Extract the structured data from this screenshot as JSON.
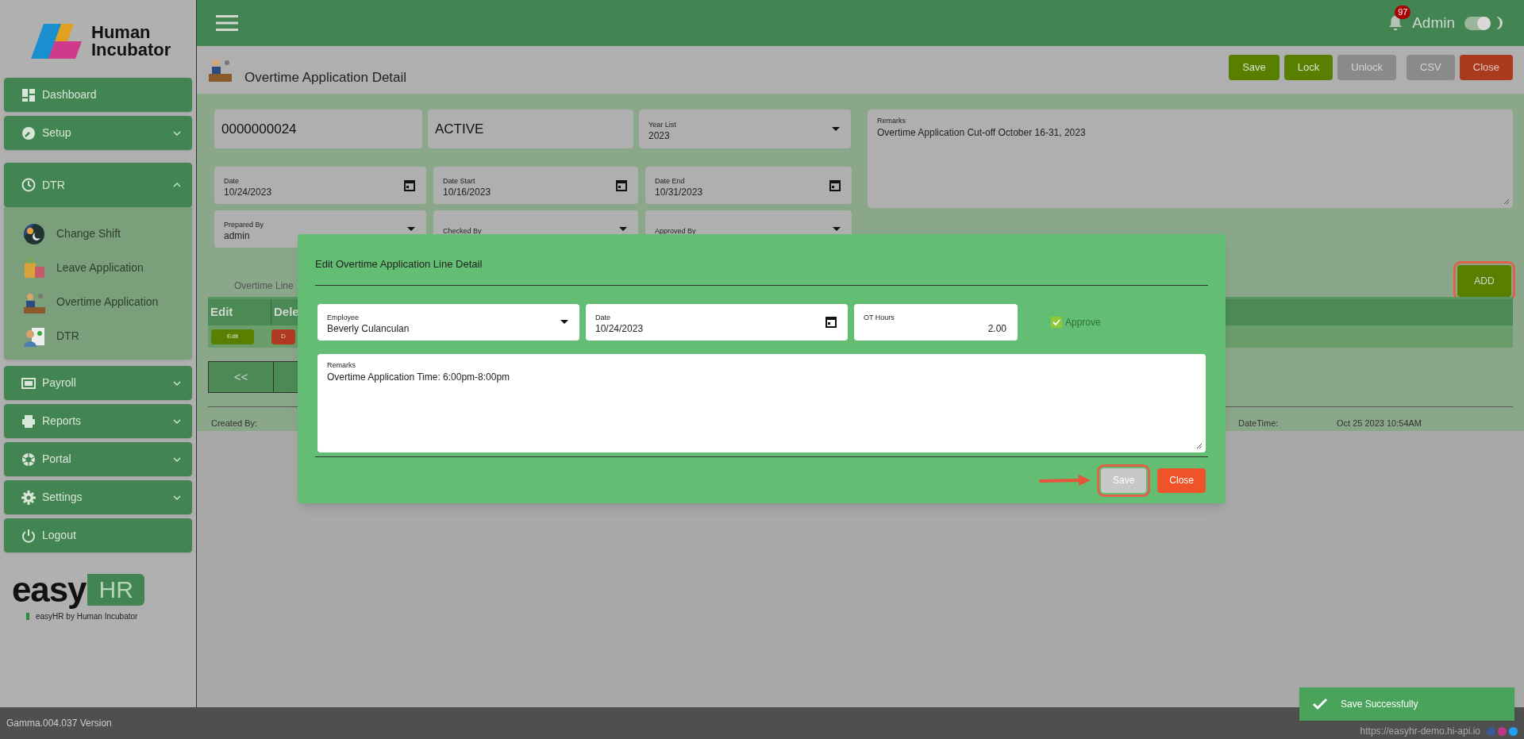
{
  "sidebar": {
    "logo": "Human Incubator",
    "items": [
      {
        "label": "Dashboard",
        "expandable": false,
        "expanded": false
      },
      {
        "label": "Setup",
        "expandable": true,
        "expanded": false
      },
      {
        "label": "DTR",
        "expandable": true,
        "expanded": true,
        "children": [
          {
            "label": "Change Shift"
          },
          {
            "label": "Leave Application"
          },
          {
            "label": "Overtime Application"
          },
          {
            "label": "DTR"
          }
        ]
      },
      {
        "label": "Payroll",
        "expandable": true,
        "expanded": false
      },
      {
        "label": "Reports",
        "expandable": true,
        "expanded": false
      },
      {
        "label": "Portal",
        "expandable": true,
        "expanded": false
      },
      {
        "label": "Settings",
        "expandable": true,
        "expanded": false
      },
      {
        "label": "Logout",
        "expandable": false,
        "expanded": false
      }
    ],
    "brand": {
      "easy": "easy",
      "hr": "HR",
      "tagline": "easyHR by Human Incubator"
    }
  },
  "header": {
    "notification_count": "97",
    "user": "Admin",
    "theme_toggle_on": true
  },
  "page": {
    "title": "Overtime Application Detail",
    "buttons": [
      {
        "label": "Save",
        "kind": "primary",
        "disabled": false
      },
      {
        "label": "Lock",
        "kind": "primary",
        "disabled": false
      },
      {
        "label": "Unlock",
        "kind": "primary",
        "disabled": true
      },
      {
        "label": "CSV",
        "kind": "primary",
        "disabled": true
      },
      {
        "label": "Close",
        "kind": "danger",
        "disabled": false
      }
    ]
  },
  "form": {
    "number": "0000000024",
    "status": "ACTIVE",
    "fields": [
      {
        "label": "Year List",
        "value": "2023",
        "kind": "select"
      },
      {
        "label": "Date",
        "value": "10/24/2023",
        "kind": "date"
      },
      {
        "label": "Date Start",
        "value": "10/16/2023",
        "kind": "date"
      },
      {
        "label": "Date End",
        "value": "10/31/2023",
        "kind": "date"
      },
      {
        "label": "Prepared By",
        "value": "admin",
        "kind": "select"
      },
      {
        "label": "Checked By",
        "kind": "select"
      },
      {
        "label": "Approved By",
        "kind": "select"
      }
    ],
    "remarks": {
      "label": "Remarks",
      "value": "Overtime Application Cut-off October 16-31, 2023"
    }
  },
  "lines": {
    "tab": "Overtime Line",
    "add_button": {
      "label": "ADD",
      "highlighted": true
    },
    "columns": [
      "Edit",
      "Dele"
    ],
    "row_buttons": [
      {
        "label": "Edit",
        "kind": "edit"
      },
      {
        "label": "D",
        "kind": "delete"
      }
    ],
    "pager": "<<"
  },
  "audit": {
    "created_by_label": "Created By:",
    "datetime_label": "DateTime:",
    "datetime_value": "Oct 25 2023 10:54AM"
  },
  "modal": {
    "title": "Edit Overtime Application Line Detail",
    "fields": [
      {
        "label": "Employee",
        "value": "Beverly  Culanculan",
        "kind": "select"
      },
      {
        "label": "Date",
        "value": "10/24/2023",
        "kind": "date"
      },
      {
        "label": "OT Hours",
        "value": "2.00",
        "kind": "number"
      }
    ],
    "approve": {
      "label": "Approve",
      "checked": true,
      "disabled": true
    },
    "remarks": {
      "label": "Remarks",
      "value": "Overtime Application Time: 6:00pm-8:00pm"
    },
    "buttons": [
      {
        "label": "Save",
        "kind": "neutral",
        "highlighted": true
      },
      {
        "label": "Close",
        "kind": "danger",
        "highlighted": false
      }
    ]
  },
  "toast": {
    "message": "Save Successfully"
  },
  "footer": {
    "version": "Gamma.004.037 Version",
    "url": "https://easyhr-demo.hi-api.io"
  }
}
